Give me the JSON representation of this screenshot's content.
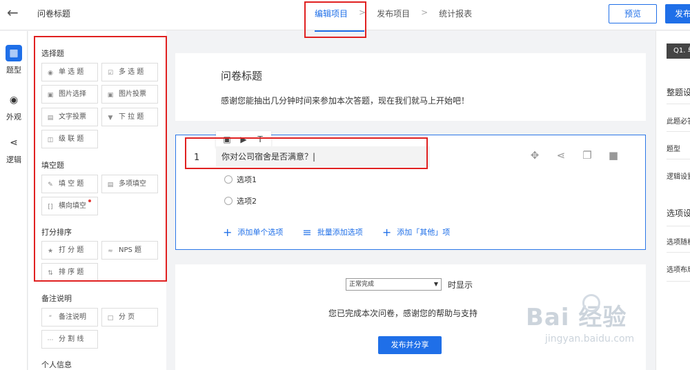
{
  "header": {
    "back_icon": "arrow-left-icon",
    "title": "问卷标题",
    "steps": [
      {
        "label": "编辑项目",
        "active": true
      },
      {
        "label": "发布项目",
        "active": false
      },
      {
        "label": "统计报表",
        "active": false
      }
    ],
    "step_separator": ">",
    "preview_label": "预览",
    "publish_label": "发布"
  },
  "iconnav": [
    {
      "label": "题型",
      "icon": "grid-icon",
      "active": true
    },
    {
      "label": "外观",
      "icon": "palette-icon",
      "active": false
    },
    {
      "label": "逻辑",
      "icon": "branch-icon",
      "active": false
    }
  ],
  "panel": {
    "sections": [
      {
        "title": "选择题",
        "items": [
          {
            "label": "单 选 题",
            "icon": "radio-icon"
          },
          {
            "label": "多 选 题",
            "icon": "checkbox-icon"
          },
          {
            "label": "图片选择",
            "icon": "image-icon"
          },
          {
            "label": "图片投票",
            "icon": "image-vote-icon"
          },
          {
            "label": "文字投票",
            "icon": "text-vote-icon"
          },
          {
            "label": "下 拉 题",
            "icon": "dropdown-icon"
          },
          {
            "label": "级 联 题",
            "icon": "cascade-icon"
          }
        ]
      },
      {
        "title": "填空题",
        "items": [
          {
            "label": "填 空 题",
            "icon": "pencil-icon"
          },
          {
            "label": "多项填空",
            "icon": "multi-fill-icon"
          },
          {
            "label": "横向填空",
            "icon": "bracket-icon",
            "badge": true
          }
        ]
      },
      {
        "title": "打分排序",
        "items": [
          {
            "label": "打 分 题",
            "icon": "star-icon"
          },
          {
            "label": "NPS 题",
            "icon": "nps-icon"
          },
          {
            "label": "排 序 题",
            "icon": "sort-icon"
          }
        ]
      },
      {
        "title": "备注说明",
        "items": [
          {
            "label": "备注说明",
            "icon": "quote-icon"
          },
          {
            "label": "分 页",
            "icon": "page-icon"
          },
          {
            "label": "分 割 线",
            "icon": "divider-icon"
          }
        ]
      },
      {
        "title": "个人信息",
        "items": []
      }
    ]
  },
  "survey": {
    "title": "问卷标题",
    "description": "感谢您能抽出几分钟时间来参加本次答题，现在我们就马上开始吧！"
  },
  "question": {
    "number": "1",
    "text": "你对公司宿舍是否满意？|",
    "toolbar_icons": [
      "image-icon",
      "video-icon",
      "text-format-icon"
    ],
    "action_icons": [
      "move-icon",
      "logic-icon",
      "copy-icon",
      "delete-icon"
    ],
    "options": [
      "选项1",
      "选项2"
    ],
    "add_actions": [
      {
        "label": "添加单个选项",
        "icon": "plus-icon"
      },
      {
        "label": "批量添加选项",
        "icon": "batch-add-icon"
      },
      {
        "label": "添加「其他」项",
        "icon": "add-other-icon"
      }
    ]
  },
  "end": {
    "select_value": "正常完成",
    "show_label": "时显示",
    "message": "您已完成本次问卷，感谢您的帮助与支持",
    "share_label": "发布并分享"
  },
  "right_panel": {
    "tag": "Q1. 单",
    "head1": "整题设",
    "items1": [
      "此题必答",
      "题型",
      "逻辑设置"
    ],
    "head2": "选项设",
    "items2": [
      "选项随机",
      "选项布局"
    ]
  },
  "watermark": {
    "main": "Bai 经验",
    "sub": "jingyan.baidu.com"
  },
  "colors": {
    "accent": "#1f6fe8",
    "highlight": "#e02020"
  }
}
